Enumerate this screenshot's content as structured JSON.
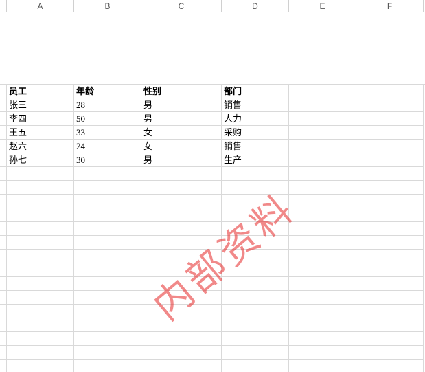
{
  "columns": [
    "A",
    "B",
    "C",
    "D",
    "E",
    "F"
  ],
  "table": {
    "headers": [
      "员工",
      "年龄",
      "性别",
      "部门"
    ],
    "rows": [
      [
        "张三",
        "28",
        "男",
        "销售"
      ],
      [
        "李四",
        "50",
        "男",
        "人力"
      ],
      [
        "王五",
        "33",
        "女",
        "采购"
      ],
      [
        "赵六",
        "24",
        "女",
        "销售"
      ],
      [
        "孙七",
        "30",
        "男",
        "生产"
      ]
    ]
  },
  "watermark": "内部资料",
  "empty_rows_after": 15
}
